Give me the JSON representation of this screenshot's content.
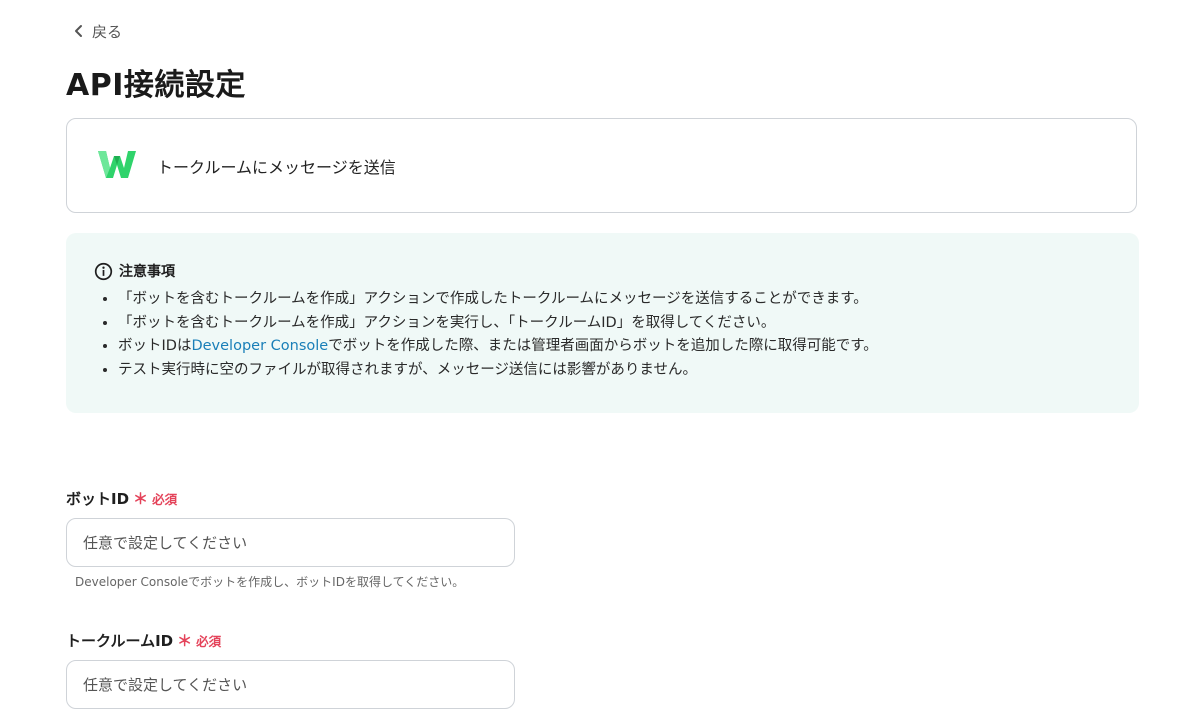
{
  "nav": {
    "back_label": "戻る"
  },
  "page": {
    "title": "API接続設定"
  },
  "action": {
    "label": "トークルームにメッセージを送信",
    "logo_icon": "line-works-logo"
  },
  "notice": {
    "heading": "注意事項",
    "items": [
      "「ボットを含むトークルームを作成」アクションで作成したトークルームにメッセージを送信することができます。",
      "「ボットを含むトークルームを作成」アクションを実行し、「トークルームID」を取得してください。",
      "ボットIDは",
      "テスト実行時に空のファイルが取得されますが、メッセージ送信には影響がありません。"
    ],
    "item3_link": "Developer Console",
    "item3_rest": "でボットを作成した際、または管理者画面からボットを追加した際に取得可能です。",
    "bg_color": "#f0f9f7",
    "link_color": "#1a7fb8"
  },
  "fields": {
    "bot_id": {
      "label": "ボットID",
      "required_mark": "＊",
      "required_text": "必須",
      "placeholder": "任意で設定してください",
      "value": "",
      "help": "Developer Consoleでボットを作成し、ボットIDを取得してください。"
    },
    "room_id": {
      "label": "トークルームID",
      "required_mark": "＊",
      "required_text": "必須",
      "placeholder": "任意で設定してください",
      "value": ""
    }
  },
  "colors": {
    "required": "#e4435a",
    "border": "#cfd3d8"
  }
}
